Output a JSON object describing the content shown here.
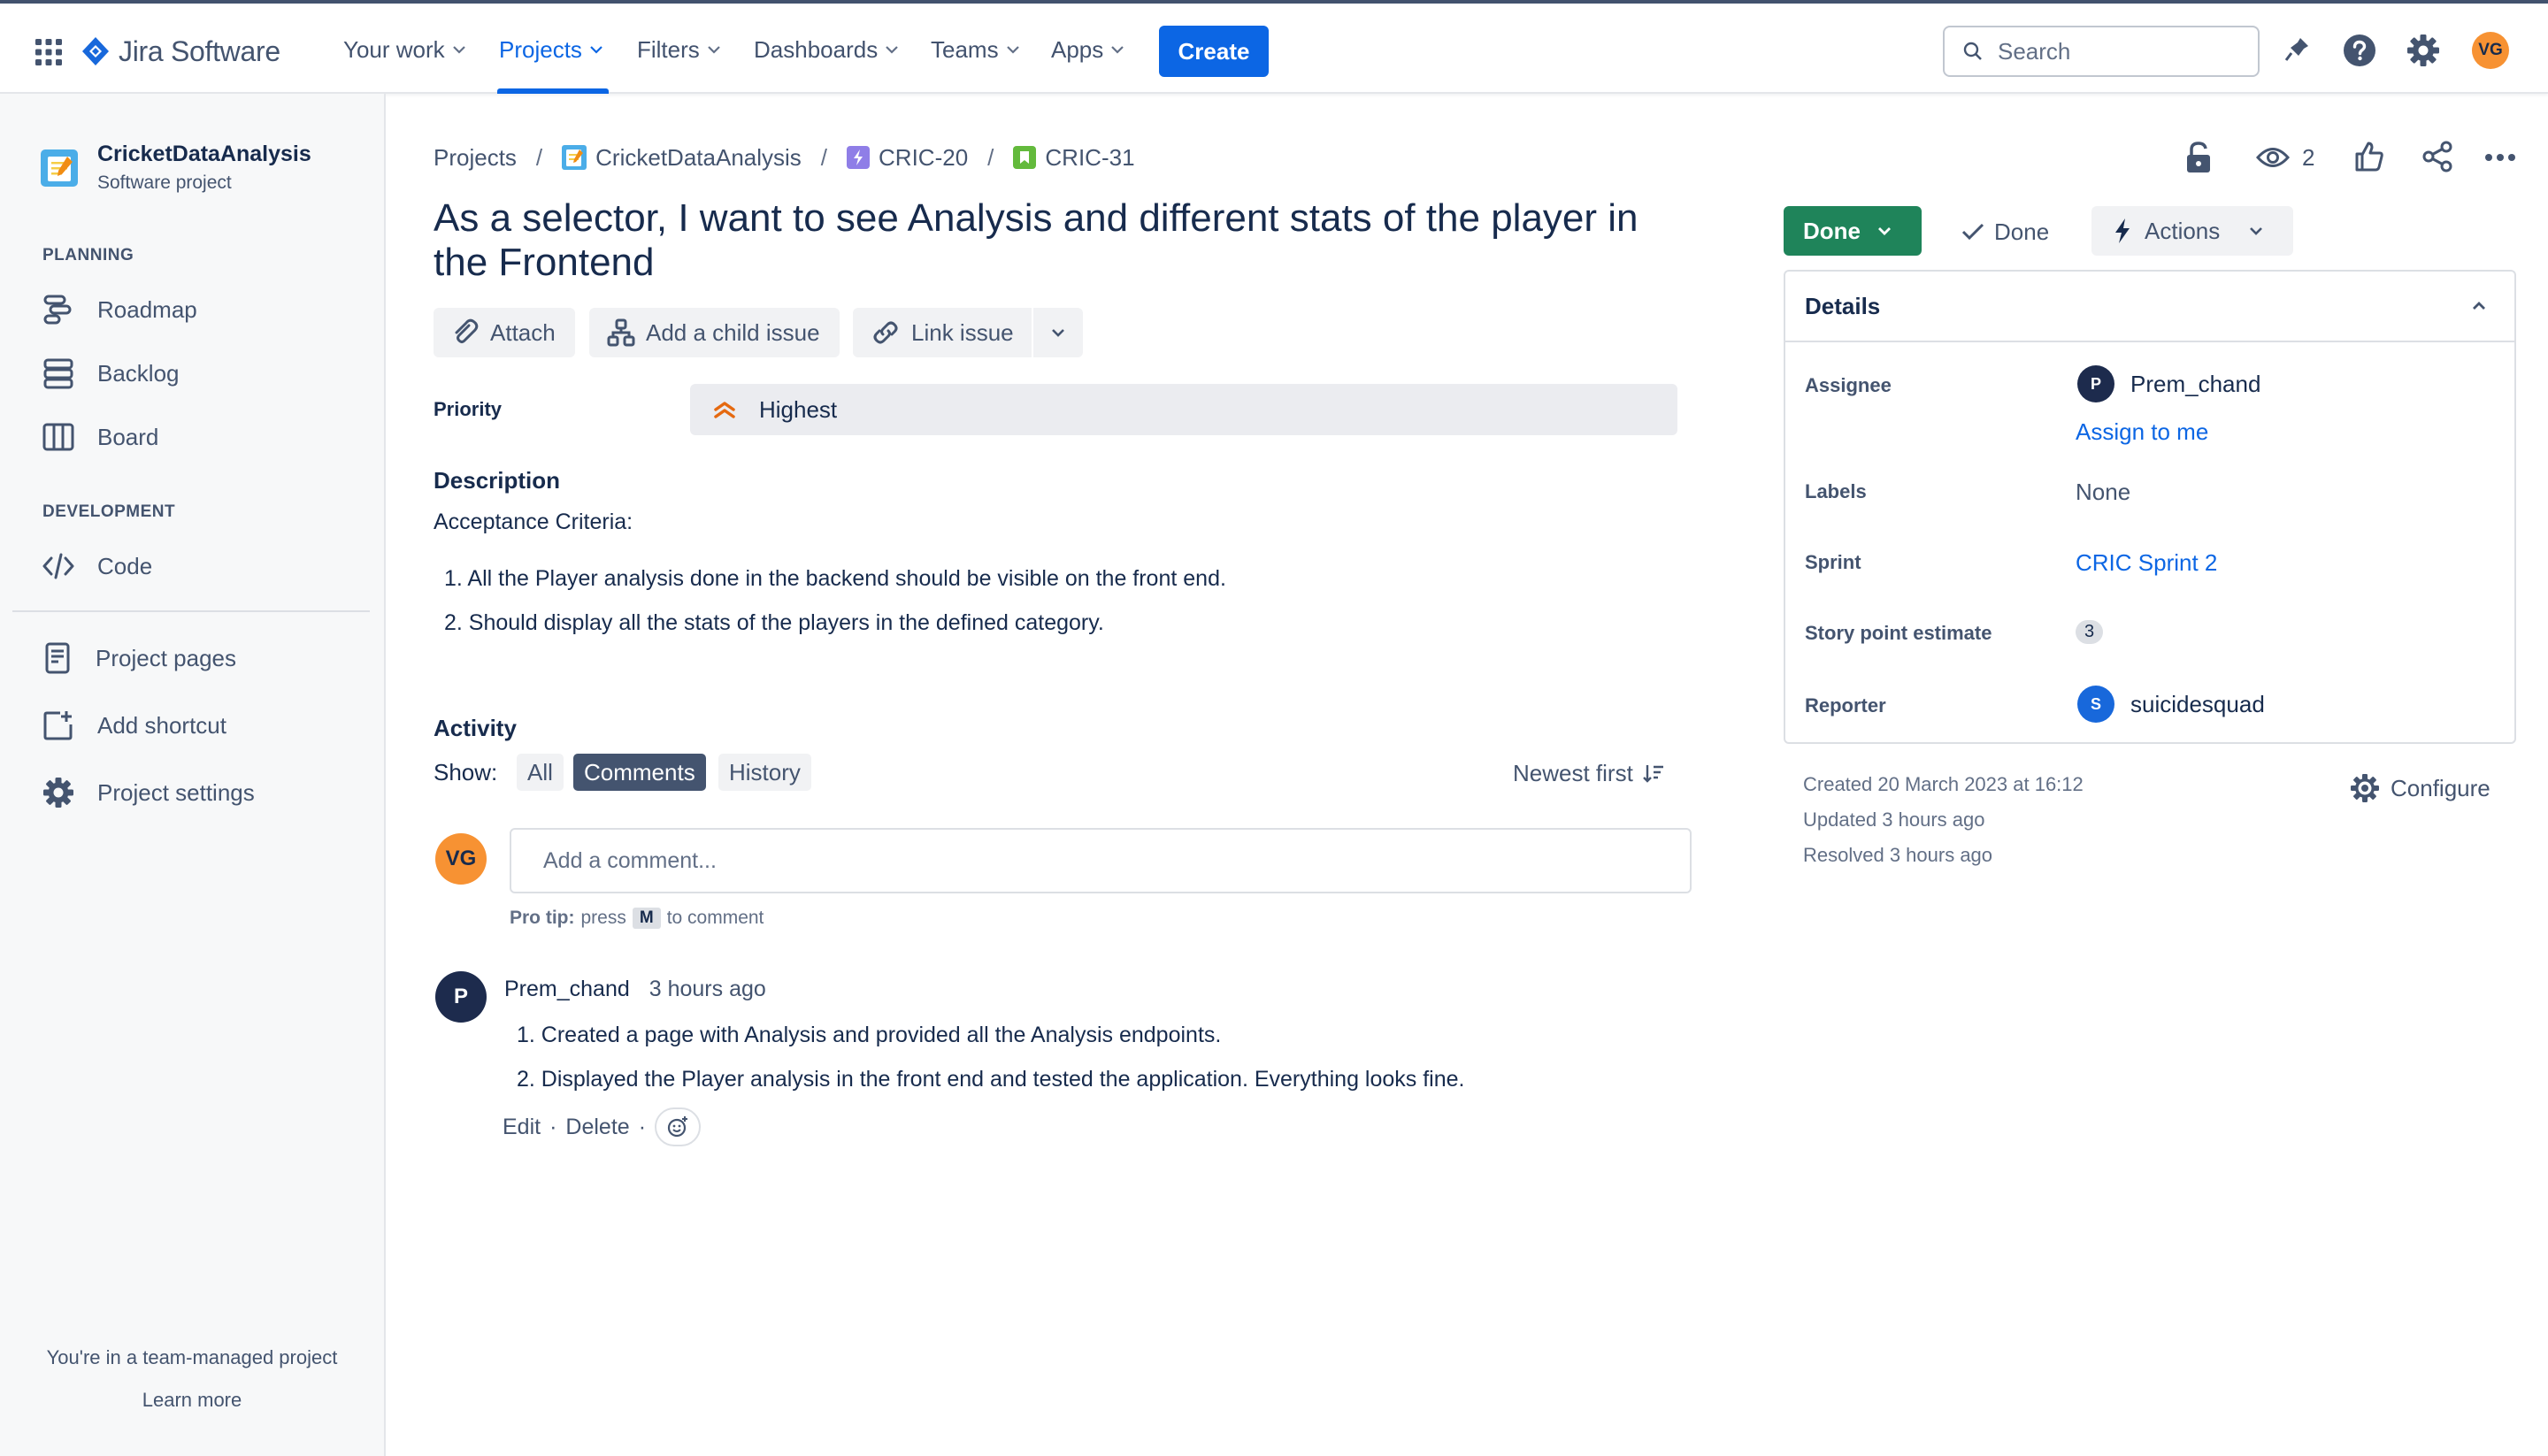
{
  "app": {
    "name": "Jira Software"
  },
  "nav": {
    "items": [
      {
        "label": "Your work"
      },
      {
        "label": "Projects"
      },
      {
        "label": "Filters"
      },
      {
        "label": "Dashboards"
      },
      {
        "label": "Teams"
      },
      {
        "label": "Apps"
      }
    ],
    "create_label": "Create",
    "search_placeholder": "Search",
    "user_initials": "VG"
  },
  "sidebar": {
    "project_name": "CricketDataAnalysis",
    "project_type": "Software project",
    "planning_heading": "PLANNING",
    "planning_items": [
      {
        "label": "Roadmap"
      },
      {
        "label": "Backlog"
      },
      {
        "label": "Board"
      }
    ],
    "development_heading": "DEVELOPMENT",
    "development_items": [
      {
        "label": "Code"
      }
    ],
    "extra_items": [
      {
        "label": "Project pages"
      },
      {
        "label": "Add shortcut"
      },
      {
        "label": "Project settings"
      }
    ],
    "footer_text": "You're in a team-managed project",
    "learn_more": "Learn more"
  },
  "breadcrumb": {
    "projects": "Projects",
    "project": "CricketDataAnalysis",
    "epic": "CRIC-20",
    "issue": "CRIC-31",
    "sep": "/"
  },
  "header_actions": {
    "watch_count": "2"
  },
  "issue": {
    "title": "As a selector, I want to see Analysis and different stats of the player in the Frontend",
    "toolbar": {
      "attach": "Attach",
      "add_child": "Add a child issue",
      "link_issue": "Link issue"
    },
    "priority_label": "Priority",
    "priority_value": "Highest",
    "description_label": "Description",
    "description_intro": "Acceptance Criteria:",
    "description_items": [
      "All the Player analysis done in the backend should be visible on the front end.",
      "Should display all the stats of the players in the defined category."
    ]
  },
  "activity": {
    "heading": "Activity",
    "show_label": "Show:",
    "tabs": [
      {
        "label": "All"
      },
      {
        "label": "Comments"
      },
      {
        "label": "History"
      }
    ],
    "sort_label": "Newest first",
    "comment_placeholder": "Add a comment...",
    "protip_bold": "Pro tip:",
    "protip_press": "press",
    "protip_key": "M",
    "protip_rest": "to comment",
    "comment": {
      "author": "Prem_chand",
      "author_initial": "P",
      "time": "3 hours ago",
      "items": [
        "Created a page with Analysis and provided all the Analysis endpoints.",
        "Displayed the Player analysis in the front end and tested the application. Everything looks fine."
      ],
      "edit": "Edit",
      "delete": "Delete",
      "dot": "·"
    }
  },
  "status": {
    "button": "Done",
    "resolution": "Done",
    "actions": "Actions"
  },
  "details": {
    "heading": "Details",
    "assignee_label": "Assignee",
    "assignee": "Prem_chand",
    "assignee_initial": "P",
    "assign_to_me": "Assign to me",
    "labels_label": "Labels",
    "labels": "None",
    "sprint_label": "Sprint",
    "sprint": "CRIC Sprint 2",
    "story_points_label": "Story point estimate",
    "story_points": "3",
    "reporter_label": "Reporter",
    "reporter": "suicidesquad",
    "reporter_initial": "S"
  },
  "meta": {
    "created": "Created 20 March 2023 at 16:12",
    "updated": "Updated 3 hours ago",
    "resolved": "Resolved 3 hours ago",
    "configure": "Configure"
  },
  "colors": {
    "brand": "#0c66e4",
    "done_green": "#1f845a",
    "priority_orange": "#e56910",
    "avatar_orange": "#f79233",
    "avatar_navy": "#1d2b4d"
  }
}
